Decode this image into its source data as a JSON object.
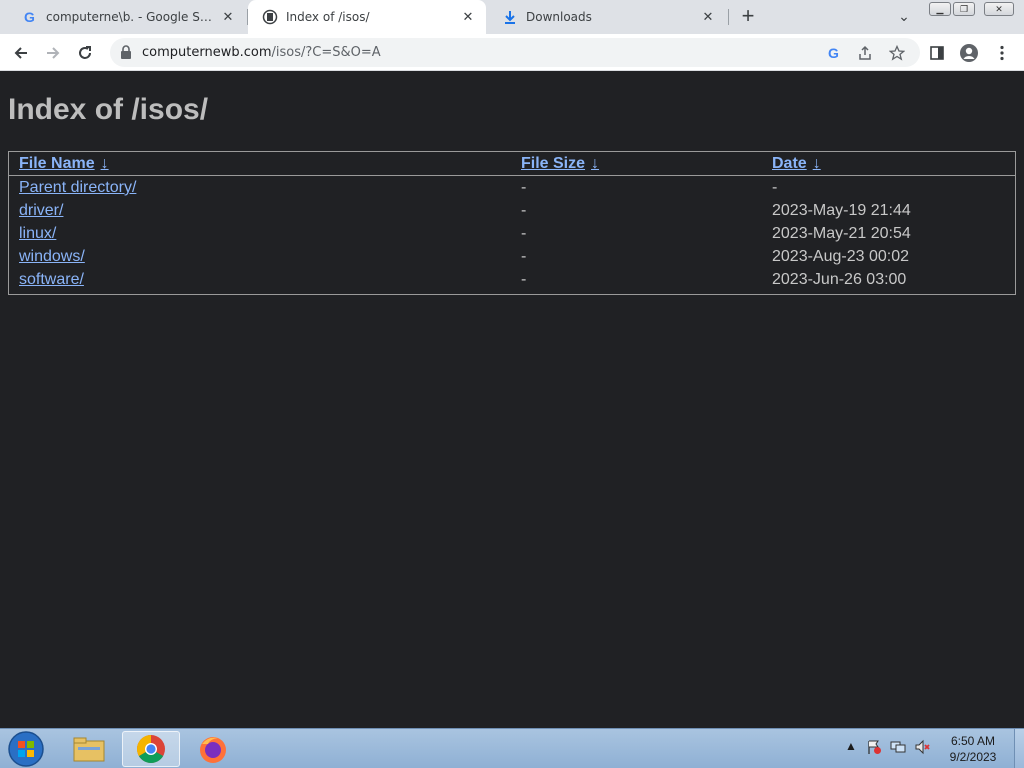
{
  "tabs": [
    {
      "title": "computerne\\b. - Google Search",
      "favicon": "google-icon",
      "active": false
    },
    {
      "title": "Index of /isos/",
      "favicon": "server-icon",
      "active": true
    },
    {
      "title": "Downloads",
      "favicon": "download-icon",
      "active": false
    }
  ],
  "omnibox": {
    "domain": "computernewb.com",
    "path": "/isos/?C=S&O=A"
  },
  "page": {
    "heading": "Index of /isos/",
    "columns": [
      {
        "label": "File Name",
        "sort": "↓"
      },
      {
        "label": "File Size",
        "sort": "↓"
      },
      {
        "label": "Date",
        "sort": "↓"
      }
    ],
    "rows": [
      {
        "name": "Parent directory/",
        "size": "-",
        "date": "-"
      },
      {
        "name": "driver/",
        "size": "-",
        "date": "2023-May-19 21:44"
      },
      {
        "name": "linux/",
        "size": "-",
        "date": "2023-May-21 20:54"
      },
      {
        "name": "windows/",
        "size": "-",
        "date": "2023-Aug-23 00:02"
      },
      {
        "name": "software/",
        "size": "-",
        "date": "2023-Jun-26 03:00"
      }
    ]
  },
  "taskbar": {
    "apps": [
      "windows-explorer",
      "google-chrome",
      "firefox"
    ],
    "clock_time": "6:50 AM",
    "clock_date": "9/2/2023"
  },
  "colors": {
    "page_bg": "#202124",
    "link": "#8ab4f8",
    "text": "#c8c8c8",
    "tabstrip": "#dee1e6"
  }
}
